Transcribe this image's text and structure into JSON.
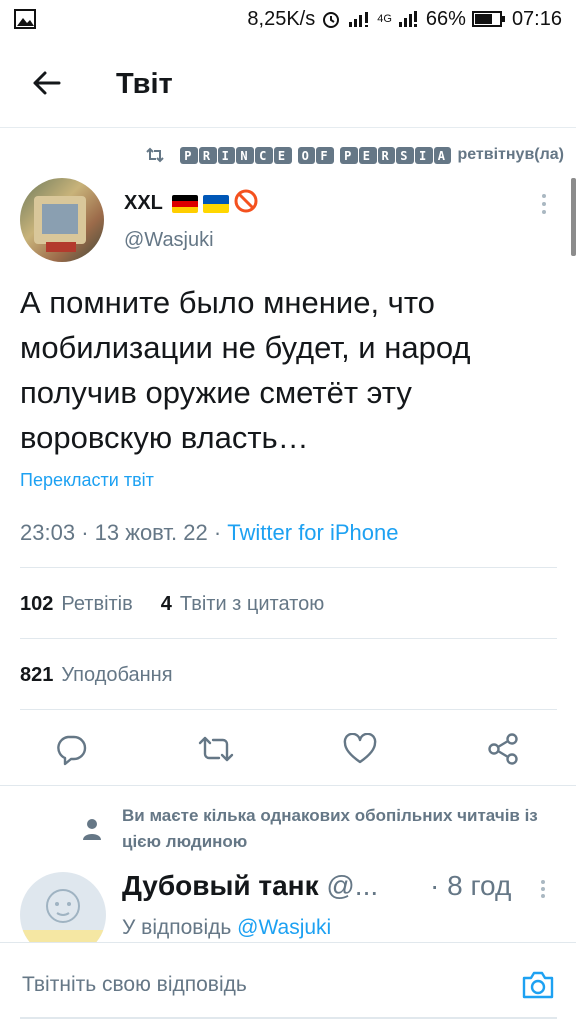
{
  "status_bar": {
    "speed": "8,25K/s",
    "network": "4G",
    "battery": "66%",
    "time": "07:16"
  },
  "header": {
    "title": "Твіт"
  },
  "retweet": {
    "retweeter_letters": [
      "P",
      "R",
      "I",
      "N",
      "C",
      "E",
      "",
      "O",
      "F",
      "",
      "P",
      "E",
      "R",
      "S",
      "I",
      "A"
    ],
    "suffix": "ретвітнув(ла)"
  },
  "tweet": {
    "author_name": "XXL",
    "author_handle": "@Wasjuki",
    "text": "А помните было мнение, что мобилизации не будет, и народ получив оружие сметёт эту воровскую власть…",
    "translate_label": "Перекласти твіт",
    "time": "23:03",
    "date": "13 жовт. 22",
    "client": "Twitter for iPhone",
    "separator": "·"
  },
  "stats": {
    "retweets_count": "102",
    "retweets_label": "Ретвітів",
    "quotes_count": "4",
    "quotes_label": "Твіти з цитатою",
    "likes_count": "821",
    "likes_label": "Уподобання"
  },
  "actions": {
    "reply_icon": "reply-icon",
    "retweet_icon": "retweet-icon",
    "like_icon": "heart-icon",
    "share_icon": "share-icon"
  },
  "social_context": {
    "text": "Ви маєте кілька однакових обопільних читачів із цією людиною"
  },
  "reply": {
    "name": "Дубовый танк",
    "handle": "@...",
    "time": "· 8 год",
    "reply_to_prefix": "У відповідь",
    "reply_to_handle": "@Wasjuki"
  },
  "composer": {
    "placeholder": "Твітніть свою відповідь"
  },
  "colors": {
    "accent": "#1da1f2",
    "secondary_text": "#657786",
    "primary_text": "#14171a"
  }
}
